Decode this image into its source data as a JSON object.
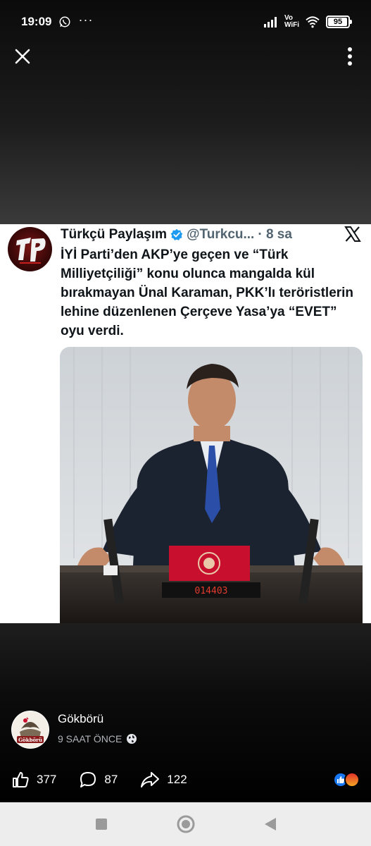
{
  "status_bar": {
    "time": "19:09",
    "dots": "···",
    "network_label_top": "Vo",
    "network_label_bottom": "WiFi",
    "battery_level": "95",
    "battery_fraction": 0.95
  },
  "tweet": {
    "author_name": "Türkçü Paylaşım",
    "handle": "@Turkcu...",
    "time_ago": "· 8 sa",
    "text": "İYİ Parti’den AKP’ye geçen ve “Türk Milliyetçiliği” konu olunca mangalda kül bırakmayan Ünal Karaman, PKK’lı teröristlerin lehine düzenlenen Çerçeve Yasa’ya “EVET” oyu verdi.",
    "photo_counter": "014403",
    "avatar_letters": "TP"
  },
  "post": {
    "page_name": "Gökbörü",
    "meta": "9 SAAT ÖNCE",
    "avatar_text": "Gökbörü",
    "likes": "377",
    "comments": "87",
    "shares": "122"
  },
  "colors": {
    "verified": "#1d9bf0",
    "like_reaction": "#1877f2",
    "podium_red": "#c8102e"
  },
  "icons": {
    "close": "close-icon",
    "more": "more-vertical-icon",
    "like": "thumbs-up-icon",
    "comment": "comment-icon",
    "share": "share-icon"
  }
}
